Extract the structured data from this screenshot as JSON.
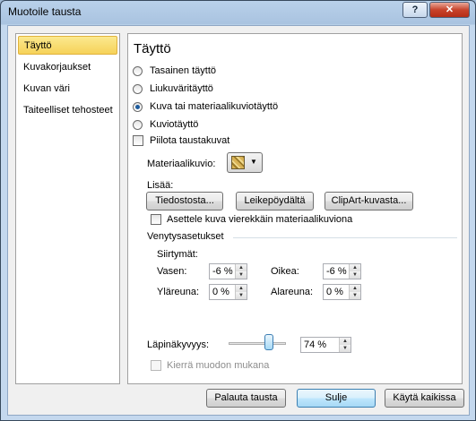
{
  "window": {
    "title": "Muotoile tausta",
    "help_label": "?",
    "close_label": "✕"
  },
  "nav": {
    "items": [
      {
        "label": "Täyttö",
        "selected": true
      },
      {
        "label": "Kuvakorjaukset",
        "selected": false
      },
      {
        "label": "Kuvan väri",
        "selected": false
      },
      {
        "label": "Taiteelliset tehosteet",
        "selected": false
      }
    ]
  },
  "fill": {
    "title": "Täyttö",
    "options": [
      {
        "label": "Tasainen täyttö",
        "selected": false
      },
      {
        "label": "Liukuväritäyttö",
        "selected": false
      },
      {
        "label": "Kuva tai materiaalikuviotäyttö",
        "selected": true
      },
      {
        "label": "Kuviotäyttö",
        "selected": false
      }
    ],
    "hide_background_label": "Piilota taustakuvat",
    "hide_background_checked": false,
    "texture_label": "Materiaalikuvio:",
    "texture_icon": "texture-swatch-icon",
    "insert_label": "Lisää:",
    "file_button": "Tiedostosta...",
    "clipboard_button": "Leikepöydältä",
    "clipart_button": "ClipArt-kuvasta...",
    "tile_label": "Asettele kuva vierekkäin materiaalikuviona",
    "tile_checked": false
  },
  "stretch": {
    "section_title": "Venytysasetukset",
    "offsets_label": "Siirtymät:",
    "left_label": "Vasen:",
    "left_value": "-6 %",
    "right_label": "Oikea:",
    "right_value": "-6 %",
    "top_label": "Yläreuna:",
    "top_value": "0 %",
    "bottom_label": "Alareuna:",
    "bottom_value": "0 %"
  },
  "transparency": {
    "label": "Läpinäkyvyys:",
    "value": "74 %",
    "fraction": 0.74
  },
  "rotate": {
    "label": "Kierrä muodon mukana",
    "checked": false,
    "disabled": true
  },
  "footer": {
    "reset_button": "Palauta tausta",
    "close_button": "Sulje",
    "apply_all_button": "Käytä kaikissa"
  },
  "colors": {
    "accent": "#3c7fb1",
    "selection": "#f6d259"
  }
}
